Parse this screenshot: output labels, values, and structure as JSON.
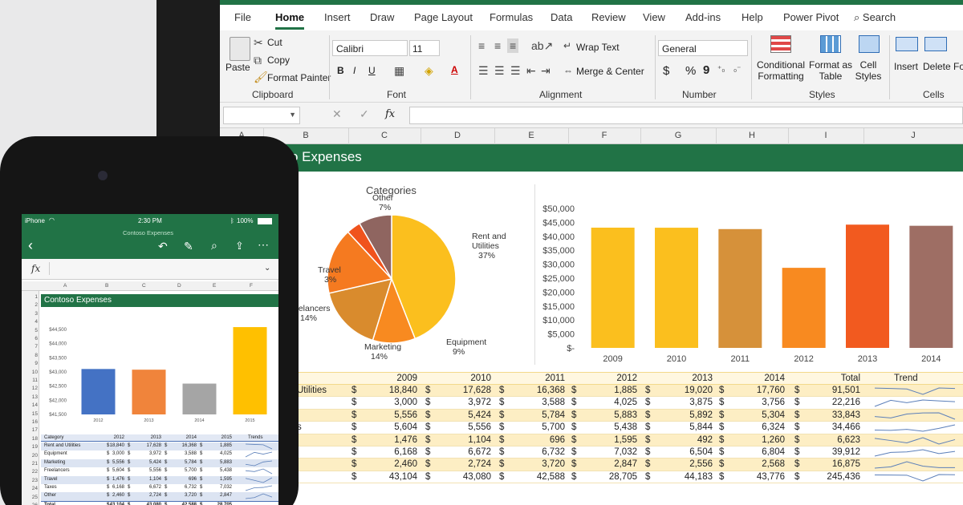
{
  "excel": {
    "tabs": [
      "File",
      "Home",
      "Insert",
      "Draw",
      "Page Layout",
      "Formulas",
      "Data",
      "Review",
      "View",
      "Add-ins",
      "Help",
      "Power Pivot"
    ],
    "active_tab": "Home",
    "search_label": "Search",
    "ribbon": {
      "paste": "Paste",
      "cut": "Cut",
      "copy": "Copy",
      "format_painter": "Format Painter",
      "clipboard": "Clipboard",
      "font_name": "Calibri",
      "font_size": "11",
      "font": "Font",
      "wrap_text": "Wrap Text",
      "merge_center": "Merge & Center",
      "alignment": "Alignment",
      "number_format": "General",
      "number": "Number",
      "conditional_formatting_1": "Conditional",
      "conditional_formatting_2": "Formatting",
      "format_as_table_1": "Format as",
      "format_as_table_2": "Table",
      "cell_styles_1": "Cell",
      "cell_styles_2": "Styles",
      "styles": "Styles",
      "insert": "Insert",
      "delete": "Delete",
      "format": "For",
      "cells": "Cells",
      "bold": "B",
      "italic": "I",
      "underline": "U",
      "font_color_glyph": "A",
      "currency": "$",
      "percent": "%",
      "comma": "9"
    },
    "formula_bar": {
      "fx": "fx"
    },
    "columns": [
      "A",
      "B",
      "C",
      "D",
      "E",
      "F",
      "G",
      "H",
      "I",
      "J"
    ],
    "sheet_title": "oso Expenses",
    "pie": {
      "title": "Categories",
      "labels": [
        {
          "name": "Other",
          "pct": "7%"
        },
        {
          "name": "Rent and Utilities",
          "pct": "37%"
        },
        {
          "name": "Travel",
          "pct": "3%"
        },
        {
          "name": "eelancers",
          "pct": "14%"
        },
        {
          "name": "Marketing",
          "pct": "14%"
        },
        {
          "name": "Equipment",
          "pct": "9%"
        }
      ]
    },
    "table": {
      "headers": [
        "2009",
        "2010",
        "2011",
        "2012",
        "2013",
        "2014",
        "Total",
        "Trend"
      ],
      "first_labels": [
        "Utilities",
        "",
        "",
        "s",
        "",
        "",
        "",
        ""
      ],
      "rows": [
        [
          "18,840",
          "17,628",
          "16,368",
          "1,885",
          "19,020",
          "17,760",
          "91,501"
        ],
        [
          "3,000",
          "3,972",
          "3,588",
          "4,025",
          "3,875",
          "3,756",
          "22,216"
        ],
        [
          "5,556",
          "5,424",
          "5,784",
          "5,883",
          "5,892",
          "5,304",
          "33,843"
        ],
        [
          "5,604",
          "5,556",
          "5,700",
          "5,438",
          "5,844",
          "6,324",
          "34,466"
        ],
        [
          "1,476",
          "1,104",
          "696",
          "1,595",
          "492",
          "1,260",
          "6,623"
        ],
        [
          "6,168",
          "6,672",
          "6,732",
          "7,032",
          "6,504",
          "6,804",
          "39,912"
        ],
        [
          "2,460",
          "2,724",
          "3,720",
          "2,847",
          "2,556",
          "2,568",
          "16,875"
        ],
        [
          "43,104",
          "43,080",
          "42,588",
          "28,705",
          "44,183",
          "43,776",
          "245,436"
        ]
      ],
      "currency_symbol": "$"
    }
  },
  "phone": {
    "carrier": "iPhone",
    "time": "2:30 PM",
    "battery": "100%",
    "workbook": "Contoso Expenses",
    "fx": "fx",
    "columns": [
      "A",
      "B",
      "C",
      "D",
      "E",
      "F"
    ],
    "row_numbers": [
      "1",
      "2",
      "3",
      "4",
      "5",
      "6",
      "7",
      "8",
      "9",
      "10",
      "11",
      "12",
      "13",
      "14",
      "15",
      "16",
      "17",
      "18",
      "19",
      "20",
      "21",
      "22",
      "23",
      "24",
      "25",
      "26",
      "27"
    ],
    "sheet_title": "Contoso Expenses",
    "table_headers": [
      "Category",
      "2012",
      "2013",
      "2014",
      "2015",
      "Trends"
    ],
    "table_rows": [
      [
        "Rent and Utilities",
        "18,840",
        "17,628",
        "16,368",
        "1,885"
      ],
      [
        "Equipment",
        "3,000",
        "3,972",
        "3,588",
        "4,025"
      ],
      [
        "Marketing",
        "5,556",
        "5,424",
        "5,784",
        "5,883"
      ],
      [
        "Freelancers",
        "5,604",
        "5,556",
        "5,700",
        "5,438"
      ],
      [
        "Travel",
        "1,476",
        "1,104",
        "696",
        "1,595"
      ],
      [
        "Taxes",
        "6,168",
        "6,672",
        "6,732",
        "7,032"
      ],
      [
        "Other",
        "2,460",
        "2,724",
        "3,720",
        "2,847"
      ],
      [
        "Total",
        "43,104",
        "43,080",
        "42,588",
        "28,705"
      ]
    ],
    "currency_symbol": "$"
  },
  "chart_data": [
    {
      "type": "bar",
      "categories": [
        "2009",
        "2010",
        "2011",
        "2012",
        "2013",
        "2014"
      ],
      "values": [
        43104,
        43080,
        42588,
        28705,
        44183,
        43776
      ],
      "title": "",
      "xlabel": "",
      "ylabel": "",
      "ylim": [
        0,
        50000
      ],
      "y_ticks": [
        "$-",
        "$5,000",
        "$10,000",
        "$15,000",
        "$20,000",
        "$25,000",
        "$30,000",
        "$35,000",
        "$40,000",
        "$45,000",
        "$50,000"
      ],
      "colors": [
        "#fbbf1e",
        "#fbbf1e",
        "#d6913a",
        "#f88a20",
        "#f25a1f",
        "#9e6e64"
      ],
      "grid": false
    },
    {
      "type": "pie",
      "title": "Categories",
      "categories": [
        "Rent and Utilities",
        "Equipment",
        "Marketing",
        "eelancers",
        "Travel",
        "Other"
      ],
      "values": [
        37,
        9,
        14,
        14,
        3,
        7
      ],
      "colors": [
        "#fbbf1e",
        "#f88a20",
        "#d98b2d",
        "#f57a20",
        "#f0531d",
        "#8f6560",
        "#a8740f"
      ]
    },
    {
      "type": "bar",
      "categories": [
        "2012",
        "2013",
        "2014",
        "2015"
      ],
      "values": [
        43104,
        43080,
        42588,
        44583
      ],
      "y_ticks": [
        "$41,500",
        "$42,000",
        "$42,500",
        "$43,000",
        "$43,500",
        "$44,000",
        "$44,500"
      ],
      "ylim": [
        41500,
        44500
      ],
      "colors": [
        "#4472c4",
        "#f0843b",
        "#a5a5a5",
        "#ffc000"
      ]
    }
  ]
}
